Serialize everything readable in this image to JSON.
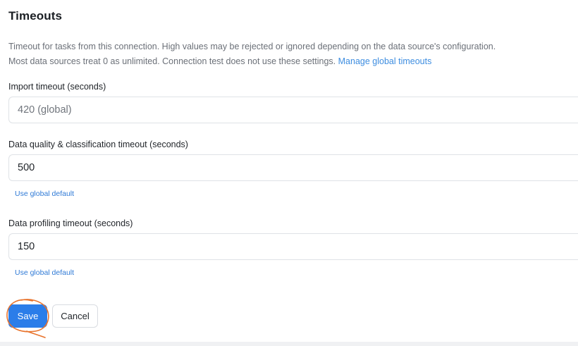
{
  "section": {
    "title": "Timeouts",
    "description_line1": "Timeout for tasks from this connection. High values may be rejected or ignored depending on the data source's configuration.",
    "description_line2": "Most data sources treat 0 as unlimited. Connection test does not use these settings. ",
    "manage_link": "Manage global timeouts"
  },
  "fields": {
    "import": {
      "label": "Import timeout (seconds)",
      "value": "",
      "placeholder": "420 (global)"
    },
    "quality": {
      "label": "Data quality & classification timeout (seconds)",
      "value": "500",
      "reset_link": "Use global default"
    },
    "profiling": {
      "label": "Data profiling timeout (seconds)",
      "value": "150",
      "reset_link": "Use global default"
    }
  },
  "actions": {
    "save_label": "Save",
    "cancel_label": "Cancel"
  },
  "colors": {
    "accent": "#2b7de9",
    "link": "#3d8de0",
    "annotation": "#e8732c"
  }
}
